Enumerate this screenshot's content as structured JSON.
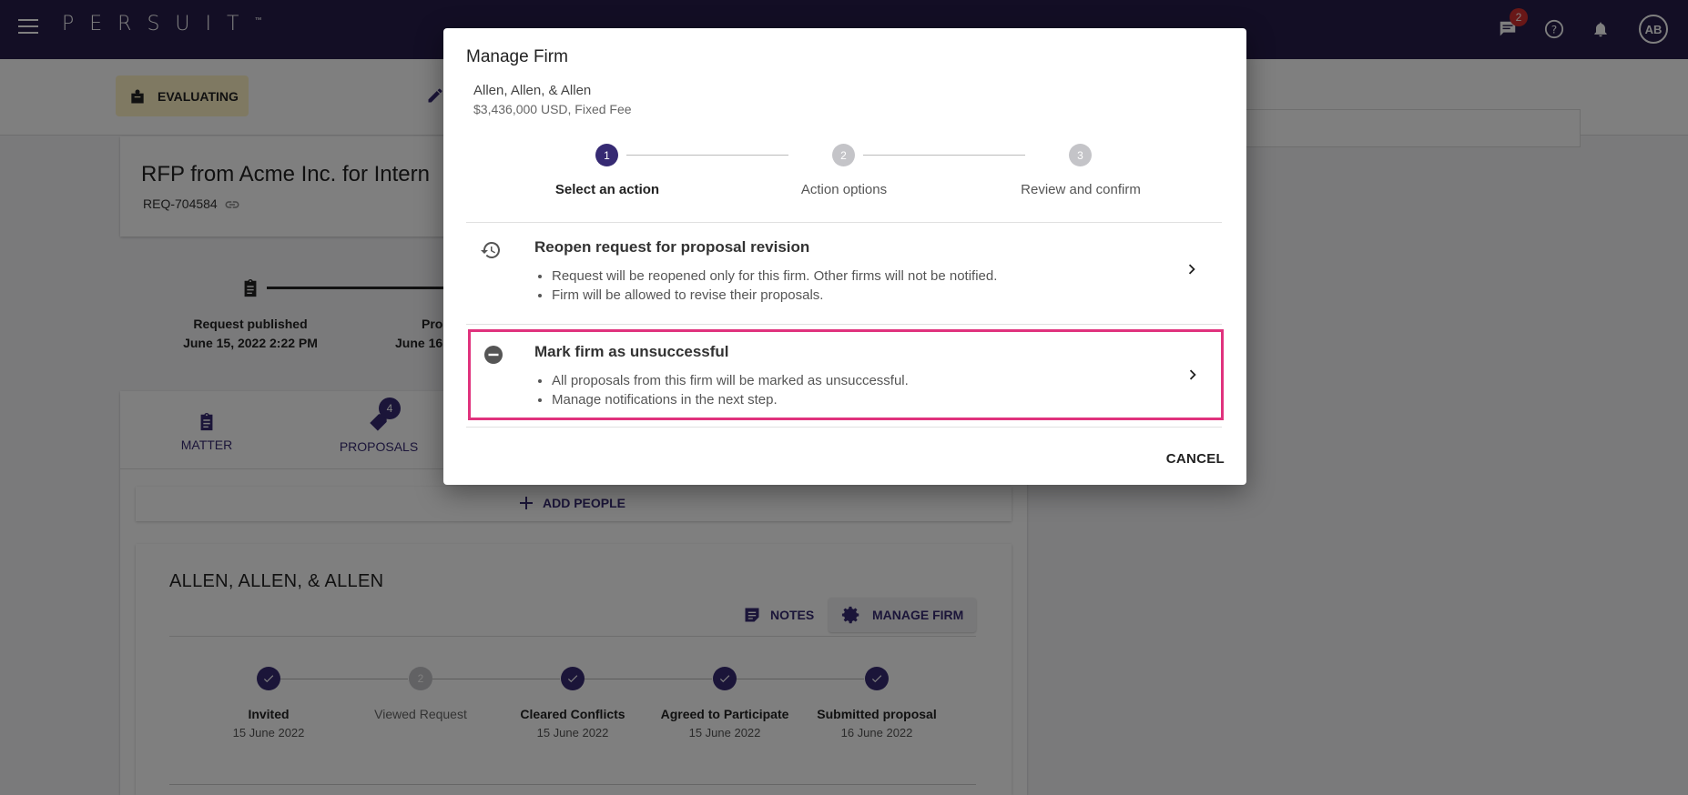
{
  "app": {
    "logo": "PERSUIT",
    "logo_mark": "™",
    "message_count": "2",
    "avatar_initials": "AB"
  },
  "header": {
    "status": "EVALUATING"
  },
  "request": {
    "title": "RFP from Acme Inc. for Intern",
    "id": "REQ-704584"
  },
  "timeline": {
    "steps": [
      {
        "label": "Request published",
        "date": "June 15, 2022 2:22 PM"
      },
      {
        "label": "Pro",
        "date": "June 16"
      }
    ]
  },
  "tabs": {
    "matter": "MATTER",
    "proposals": "PROPOSALS",
    "proposals_count": "4"
  },
  "people": {
    "add_label": "ADD PEOPLE"
  },
  "firm_card": {
    "name": "ALLEN, ALLEN, & ALLEN",
    "notes_label": "NOTES",
    "manage_label": "MANAGE FIRM",
    "progress": [
      {
        "label": "Invited",
        "date": "15 June 2022",
        "done": true
      },
      {
        "label": "Viewed Request",
        "date": "",
        "done": false,
        "number": "2"
      },
      {
        "label": "Cleared Conflicts",
        "date": "15 June 2022",
        "done": true
      },
      {
        "label": "Agreed to Participate",
        "date": "15 June 2022",
        "done": true
      },
      {
        "label": "Submitted proposal",
        "date": "16 June 2022",
        "done": true
      }
    ]
  },
  "modal": {
    "title": "Manage Firm",
    "firm": "Allen, Allen, & Allen",
    "fee": "$3,436,000 USD, Fixed Fee",
    "steps": [
      {
        "number": "1",
        "label": "Select an action"
      },
      {
        "number": "2",
        "label": "Action options"
      },
      {
        "number": "3",
        "label": "Review and confirm"
      }
    ],
    "options": [
      {
        "title": "Reopen request for proposal revision",
        "bullets": [
          "Request will be reopened only for this firm. Other firms will not be notified.",
          "Firm will be allowed to revise their proposals."
        ]
      },
      {
        "title": "Mark firm as unsuccessful",
        "bullets": [
          "All proposals from this firm will be marked as unsuccessful.",
          "Manage notifications in the next step."
        ]
      }
    ],
    "cancel_label": "CANCEL"
  },
  "colors": {
    "topbar": "#261d4b",
    "accent": "#362a73",
    "highlight": "#e0327d",
    "status_chip": "#fff3c4"
  }
}
